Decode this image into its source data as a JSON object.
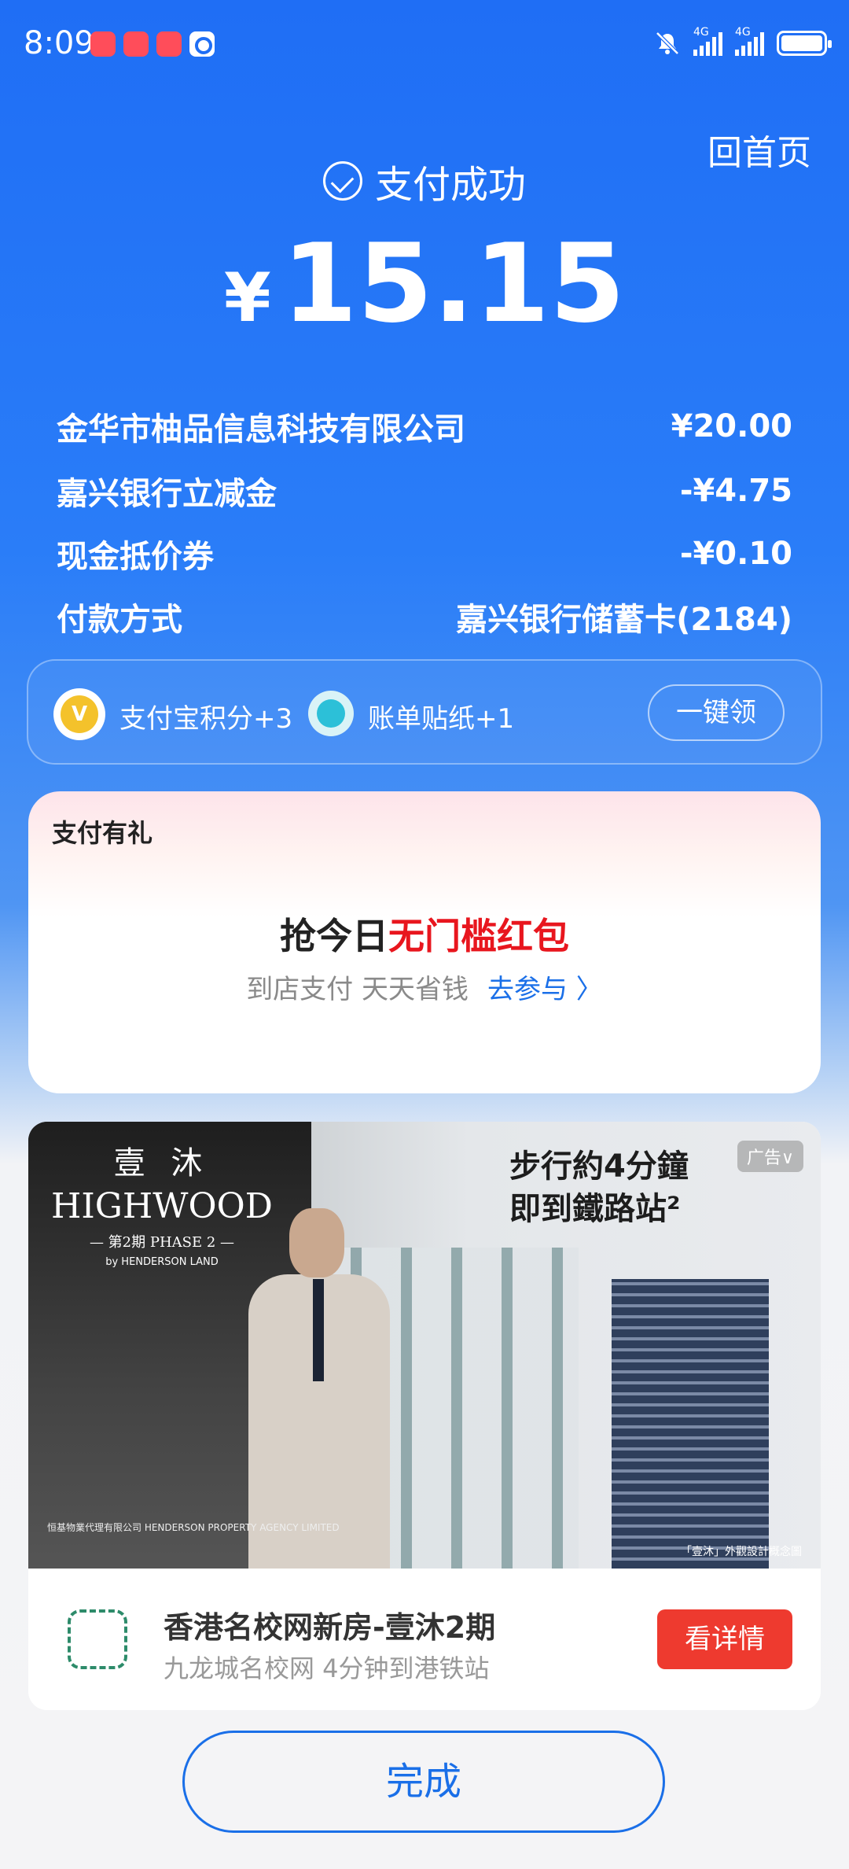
{
  "status_bar": {
    "time": "8:09",
    "net1": "4G",
    "net2": "4G"
  },
  "header": {
    "home_label": "回首页",
    "status_text": "支付成功",
    "currency_symbol": "¥",
    "amount": "15.15"
  },
  "details": [
    {
      "label": "金华市柚品信息科技有限公司",
      "value": "¥20.00"
    },
    {
      "label": "嘉兴银行立减金",
      "value": "-¥4.75"
    },
    {
      "label": "现金抵价券",
      "value": "-¥0.10"
    },
    {
      "label": "付款方式",
      "value": "嘉兴银行储蓄卡(2184)"
    }
  ],
  "rewards": {
    "points_label": "支付宝积分+3",
    "sticker_label": "账单贴纸+1",
    "claim_button": "一键领"
  },
  "gift": {
    "title": "支付有礼",
    "headline_prefix": "抢今日",
    "headline_highlight": "无门槛红包",
    "subtext": "到店支付 天天省钱",
    "link": "去参与 〉"
  },
  "ad": {
    "logo_cn": "壹 沐",
    "logo_en": "HIGHWOOD",
    "logo_phase": "— 第2期 PHASE 2 —",
    "logo_by": "by HENDERSON LAND",
    "headline_line1": "步行約4分鐘",
    "headline_line2": "即到鐵路站²",
    "badge": "广告∨",
    "footer_text": "恒基物業代理有限公司 HENDERSON PROPERTY AGENCY LIMITED",
    "caption": "「壹沐」外觀設計概念圖",
    "title": "香港名校网新房-壹沐2期",
    "subtitle": "九龙城名校网 4分钟到港铁站",
    "cta": "看详情"
  },
  "done_button": "完成"
}
